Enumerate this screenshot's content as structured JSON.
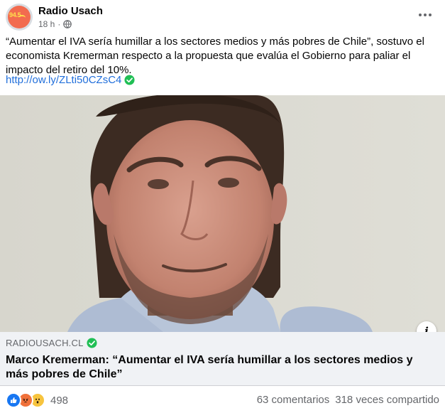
{
  "post": {
    "page_name": "Radio Usach",
    "avatar_text": "94.5",
    "timestamp": "18 h",
    "separator": "·",
    "privacy_icon": "globe-icon",
    "more_icon": "more-options-icon",
    "caption": "“Aumentar el IVA sería humillar a los sectores medios y más pobres de Chile”, sostuvo el economista Kremerman respecto a la propuesta que evalúa el Gobierno para paliar el impacto del retiro del 10%.",
    "link_text": "http://ow.ly/ZLti50CZsC4",
    "verified_icon": "verified-check-icon"
  },
  "link_preview": {
    "domain": "RADIOUSACH.CL",
    "title": "Marco Kremerman: “Aumentar el IVA sería humillar a los sectores medios y más pobres de Chile”",
    "info_icon": "info-icon"
  },
  "engagement": {
    "reaction_icons": [
      "like-icon",
      "angry-icon",
      "wow-icon"
    ],
    "reaction_count": "498",
    "comments": "63 comentarios",
    "shares": "318 veces compartido"
  },
  "colors": {
    "link": "#216fdb",
    "verified": "#20bf55",
    "secondary_text": "#65676b",
    "preview_bg": "#f0f2f5"
  }
}
